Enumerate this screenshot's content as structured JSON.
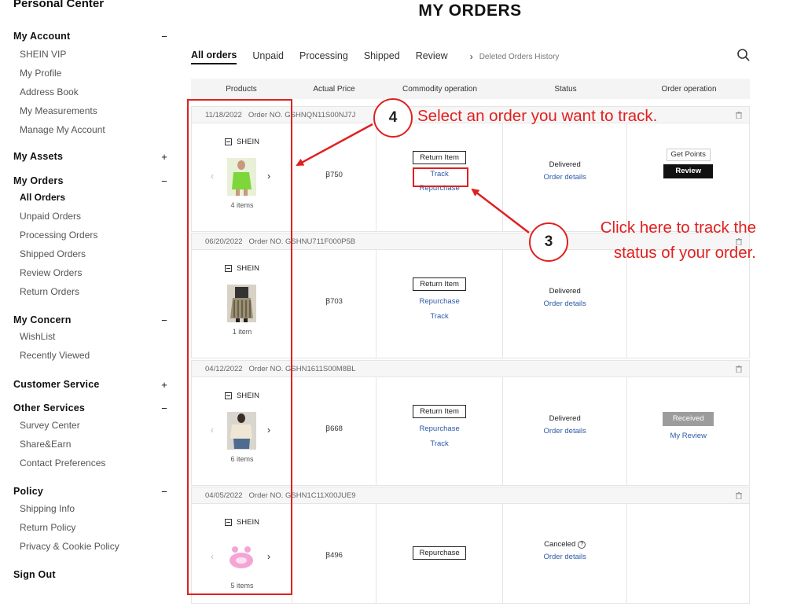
{
  "sidebar": {
    "title": "Personal Center",
    "groups": [
      {
        "label": "My Account",
        "toggle": "−",
        "items": [
          "SHEIN VIP",
          "My Profile",
          "Address Book",
          "My Measurements",
          "Manage My Account"
        ]
      },
      {
        "label": "My Assets",
        "toggle": "+",
        "items": []
      },
      {
        "label": "My Orders",
        "toggle": "−",
        "items": [
          "All Orders",
          "Unpaid Orders",
          "Processing Orders",
          "Shipped Orders",
          "Review Orders",
          "Return Orders"
        ]
      },
      {
        "label": "My Concern",
        "toggle": "−",
        "items": [
          "WishList",
          "Recently Viewed"
        ]
      },
      {
        "label": "Customer Service",
        "toggle": "+",
        "items": []
      },
      {
        "label": "Other Services",
        "toggle": "−",
        "items": [
          "Survey Center",
          "Share&Earn",
          "Contact Preferences"
        ]
      },
      {
        "label": "Policy",
        "toggle": "−",
        "items": [
          "Shipping Info",
          "Return Policy",
          "Privacy & Cookie Policy"
        ]
      }
    ],
    "sign_out": "Sign Out"
  },
  "page_title": "MY ORDERS",
  "tabs": [
    "All orders",
    "Unpaid",
    "Processing",
    "Shipped",
    "Review"
  ],
  "deleted_history": "Deleted Orders History",
  "columns": [
    "Products",
    "Actual Price",
    "Commodity operation",
    "Status",
    "Order operation"
  ],
  "orders": [
    {
      "date": "11/18/2022",
      "order_no": "Order NO. GSHNQN11S00NJ7J",
      "store": "SHEIN",
      "items": "4 items",
      "price": "Ꞵ750",
      "ops": [
        "Return Item",
        "Track",
        "Repurchase"
      ],
      "status": "Delivered",
      "details": "Order details",
      "order_ops": [
        "Get Points",
        "Review"
      ]
    },
    {
      "date": "06/20/2022",
      "order_no": "Order NO. GSHNU711F000P5B",
      "store": "SHEIN",
      "items": "1 item",
      "price": "Ꞵ703",
      "ops": [
        "Return Item",
        "Repurchase",
        "Track"
      ],
      "status": "Delivered",
      "details": "Order details",
      "order_ops": []
    },
    {
      "date": "04/12/2022",
      "order_no": "Order NO. GSHN1611S00M8BL",
      "store": "SHEIN",
      "items": "6 items",
      "price": "Ꞵ668",
      "ops": [
        "Return Item",
        "Repurchase",
        "Track"
      ],
      "status": "Delivered",
      "details": "Order details",
      "order_ops": [
        "Received",
        "My Review"
      ]
    },
    {
      "date": "04/05/2022",
      "order_no": "Order NO. GSHN1C11X00JUE9",
      "store": "SHEIN",
      "items": "5 items",
      "price": "Ꞵ496",
      "ops": [
        "Repurchase"
      ],
      "status": "Canceled",
      "details": "Order details",
      "order_ops": []
    }
  ],
  "annotations": {
    "step4_number": "4",
    "step4_text": "Select an order you want to track.",
    "step3_number": "3",
    "step3_line1": "Click here to track the",
    "step3_line2": "status of your order."
  },
  "colors": {
    "annotation_red": "#e02020",
    "link_blue": "#2b5aa8",
    "review_black": "#111111",
    "received_gray": "#9c9c9c"
  }
}
